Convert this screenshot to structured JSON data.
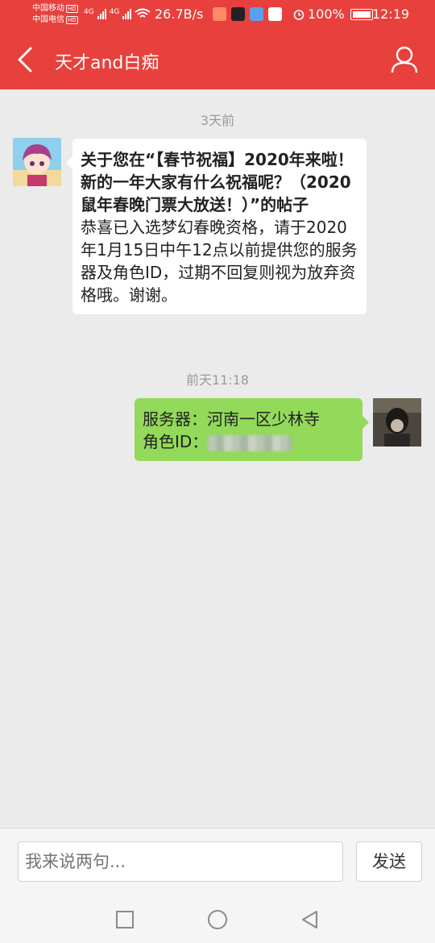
{
  "status_bar": {
    "carrier1": "中国移动",
    "carrier2": "中国电信",
    "hd": "HD",
    "net1": "4G",
    "net2": "4G",
    "netspeed": "26.7B/s",
    "battery": "100%",
    "time": "12:19",
    "app_icons": [
      "maps-icon",
      "dashen-icon",
      "photos-icon",
      "video-icon"
    ]
  },
  "header": {
    "title": "天才and白痴",
    "back_icon": "back-chevron-icon",
    "profile_icon": "user-profile-icon"
  },
  "messages": [
    {
      "timestamp": "3天前",
      "side": "left",
      "subject": "关于您在“【春节祝福】2020年来啦！新的一年大家有什么祝福呢？（2020鼠年春晚门票大放送！）”的帖子",
      "body": "恭喜已入选梦幻春晚资格，请于2020年1月15日中午12点以前提供您的服务器及角色ID，过期不回复则视为放弃资格哦。谢谢。"
    },
    {
      "timestamp": "前天11:18",
      "side": "right",
      "line1": "服务器：河南一区少林寺",
      "line2_label": "角色ID："
    }
  ],
  "input_bar": {
    "placeholder": "我来说两句...",
    "send_label": "发送"
  },
  "nav": {
    "recent_icon": "square-icon",
    "home_icon": "circle-icon",
    "back_icon": "triangle-back-icon"
  },
  "colors": {
    "brand_red": "#e8403c",
    "bubble_green": "#93d95a",
    "background": "#ebebeb"
  }
}
